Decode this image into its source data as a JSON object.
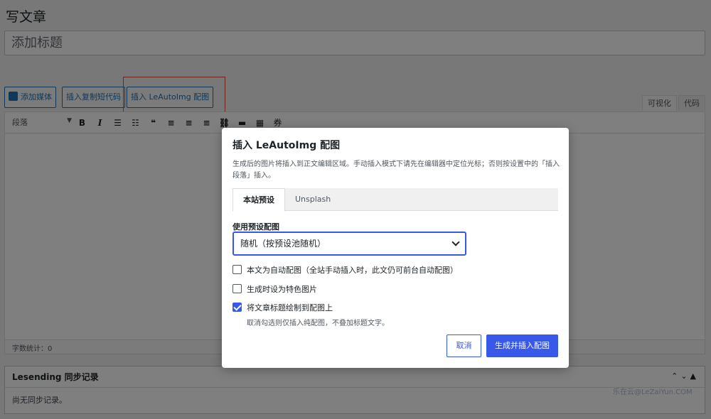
{
  "page": {
    "title": "写文章",
    "post_title_placeholder": "添加标题"
  },
  "editor": {
    "buttons": {
      "add_media": "添加媒体",
      "insert_copy_shortcode": "插入复制短代码",
      "insert_leautoimg": "插入 LeAutoImg 配图"
    },
    "mode_tabs": [
      "可视化",
      "代码"
    ],
    "format_select": "段落",
    "toolbar_icons": [
      "bold-icon",
      "italic-icon",
      "bulleted-list-icon",
      "numbered-list-icon",
      "blockquote-icon",
      "align-left-icon",
      "align-center-icon",
      "align-right-icon",
      "link-icon",
      "read-more-icon",
      "toolbar-toggle-icon",
      "coupon-icon"
    ],
    "toolbar_glyphs": {
      "bold": "B",
      "italic": "I",
      "coupon": "券"
    },
    "word_count": "字数统计：0"
  },
  "metabox": {
    "title": "Lesending 同步记录",
    "body": "尚无同步记录。"
  },
  "watermark": "乐在云@LeZaiYun.COM",
  "modal": {
    "title": "插入 LeAutoImg 配图",
    "description": "生成后的图片将插入到正文编辑区域。手动插入模式下请先在编辑器中定位光标；否则按设置中的「插入段落」插入。",
    "tabs": [
      "本站预设",
      "Unsplash"
    ],
    "active_tab": "本站预设",
    "preset_label": "使用预设配图",
    "preset_value": "随机（按预设池随机）",
    "options": {
      "auto_image": {
        "label": "本文为自动配图（全站手动插入时，此文仍可前台自动配图）",
        "checked": false
      },
      "featured": {
        "label": "生成时设为特色图片",
        "checked": false
      },
      "draw_title": {
        "label": "将文章标题绘制到配图上",
        "checked": true,
        "hint": "取消勾选则仅插入纯配图，不叠加标题文字。"
      }
    },
    "cancel_label": "取消",
    "submit_label": "生成并插入配图"
  },
  "colors": {
    "accent": "#3858e9",
    "wp_blue": "#2271b1",
    "highlight_outline": "#e74c3c"
  }
}
